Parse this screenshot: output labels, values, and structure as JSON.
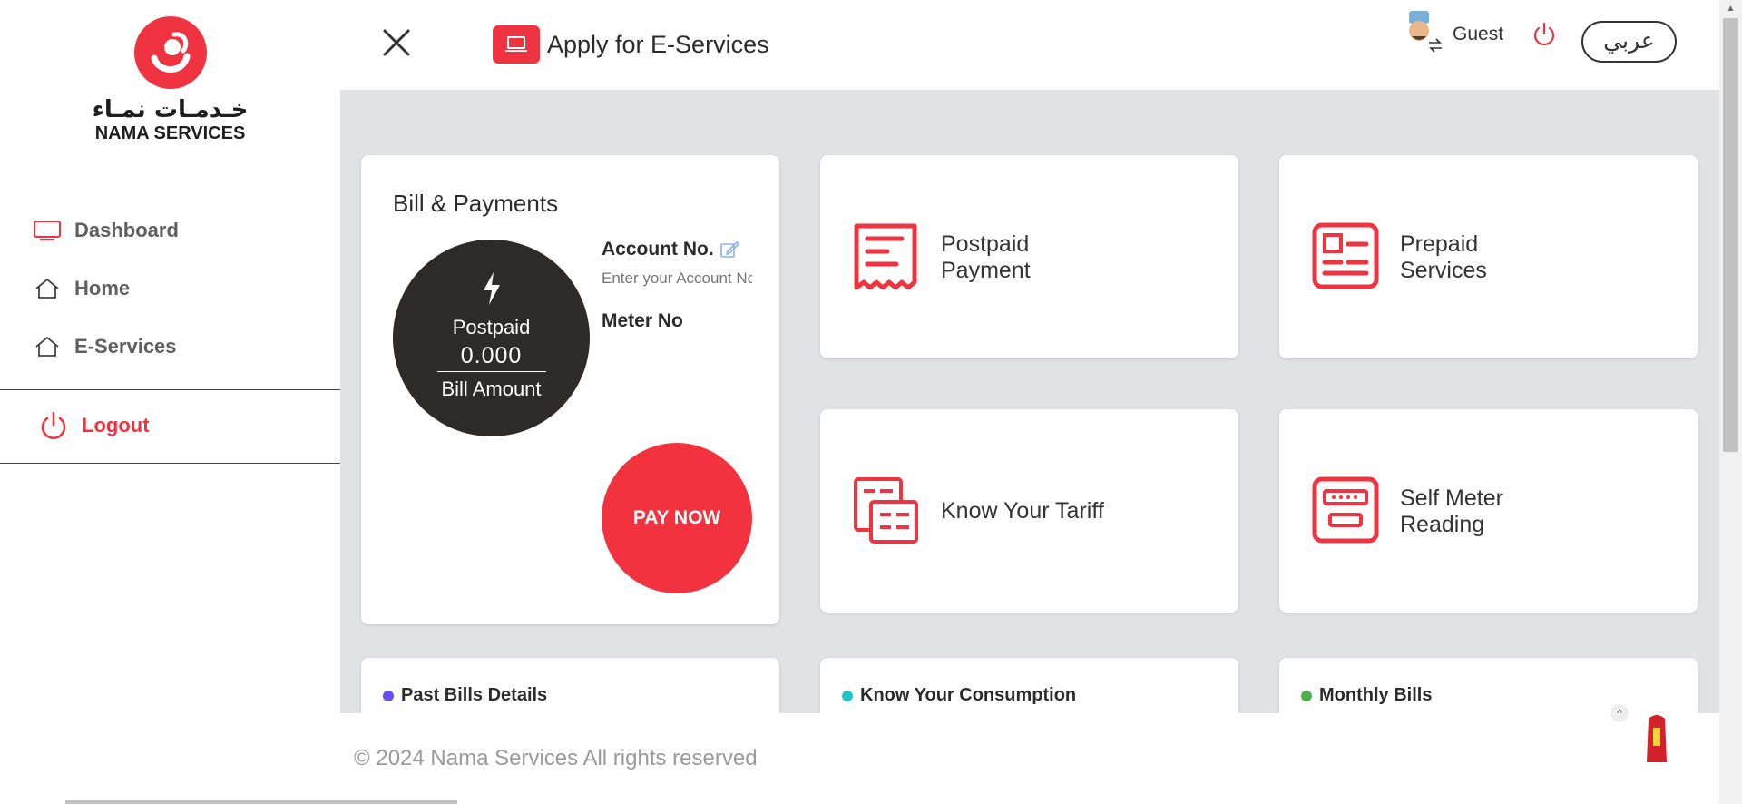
{
  "brand": {
    "name_ar": "خـدمـات نمـاء",
    "name_en": "NAMA SERVICES",
    "accent_color": "#ef3340"
  },
  "sidebar": {
    "items": [
      {
        "label": "Dashboard",
        "icon": "monitor-icon"
      },
      {
        "label": "Home",
        "icon": "home-icon"
      },
      {
        "label": "E-Services",
        "icon": "home-icon"
      }
    ],
    "logout_label": "Logout"
  },
  "header": {
    "title": "Apply for E-Services",
    "user_name": "Guest",
    "language_button": "عربي"
  },
  "bill": {
    "title": "Bill & Payments",
    "bill_type": "Postpaid",
    "amount": "0.000",
    "amount_label": "Bill Amount",
    "account_label": "Account No.",
    "account_placeholder": "Enter your Account No",
    "meter_label": "Meter No",
    "pay_button": "PAY NOW"
  },
  "services": [
    {
      "label_line1": "Postpaid",
      "label_line2": "Payment",
      "icon": "receipt-icon"
    },
    {
      "label_line1": "Prepaid",
      "label_line2": "Services",
      "icon": "id-card-icon"
    },
    {
      "label_line1": "Know Your Tariff",
      "label_line2": "",
      "icon": "documents-icon"
    },
    {
      "label_line1": "Self Meter",
      "label_line2": "Reading",
      "icon": "meter-icon"
    }
  ],
  "panels": [
    {
      "label": "Past Bills Details",
      "dot_color": "#6a4cf5"
    },
    {
      "label": "Know Your Consumption",
      "dot_color": "#21c4c4"
    },
    {
      "label": "Monthly Bills",
      "dot_color": "#4caf50"
    }
  ],
  "footer": {
    "copyright": "© 2024 Nama Services All rights reserved"
  }
}
